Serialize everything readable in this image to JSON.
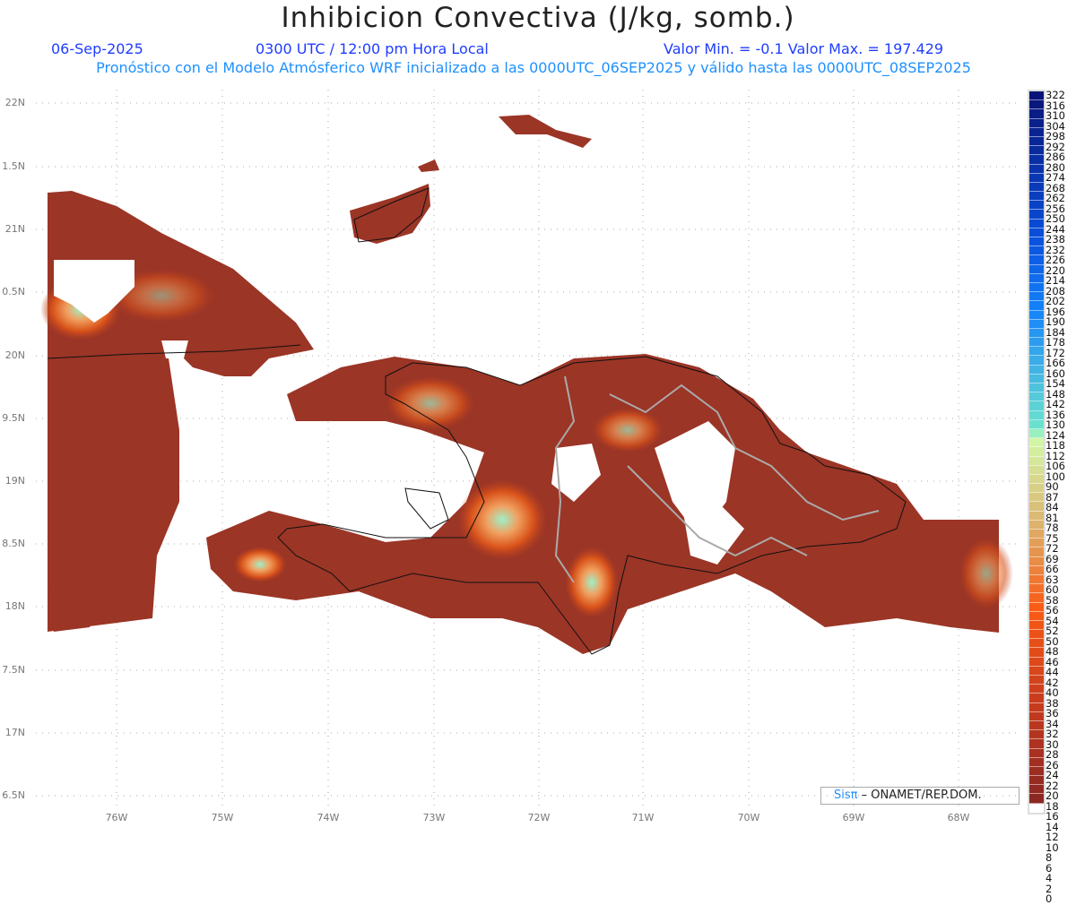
{
  "header": {
    "title": "Inhibicion Convectiva (J/kg, somb.)",
    "date": "06-Sep-2025",
    "time": "0300 UTC / 12:00 pm Hora Local",
    "minmax": "Valor Min. = -0.1  Valor Max. = 197.429",
    "subtitle": "Pronóstico con el Modelo Atmósferico WRF inicializado a las 0000UTC_06SEP2025 y válido hasta las  0000UTC_08SEP2025"
  },
  "axes": {
    "y_labels": [
      "22N",
      "1.5N",
      "21N",
      "0.5N",
      "20N",
      "9.5N",
      "19N",
      "8.5N",
      "18N",
      "7.5N",
      "17N",
      "6.5N"
    ],
    "x_labels": [
      "76W",
      "75W",
      "74W",
      "73W",
      "72W",
      "71W",
      "70W",
      "69W",
      "68W"
    ]
  },
  "colorbar": {
    "labels": [
      "322",
      "316",
      "310",
      "304",
      "298",
      "292",
      "286",
      "280",
      "274",
      "268",
      "262",
      "256",
      "250",
      "244",
      "238",
      "232",
      "226",
      "220",
      "214",
      "208",
      "202",
      "196",
      "190",
      "184",
      "178",
      "172",
      "166",
      "160",
      "154",
      "148",
      "142",
      "136",
      "130",
      "124",
      "118",
      "112",
      "106",
      "100",
      "90",
      "87",
      "84",
      "81",
      "78",
      "75",
      "72",
      "69",
      "66",
      "63",
      "60",
      "58",
      "56",
      "54",
      "52",
      "50",
      "48",
      "46",
      "44",
      "42",
      "40",
      "38",
      "36",
      "34",
      "32",
      "30",
      "28",
      "26",
      "24",
      "22",
      "20",
      "18",
      "16",
      "14",
      "12",
      "10",
      "8",
      "6",
      "4",
      "2",
      "0"
    ]
  },
  "footer": {
    "logo_brand": "Sisπ",
    "logo_text": " – ONAMET/REP.DOM."
  },
  "colors": {
    "land": "#9b3526",
    "mid": "#d9531a",
    "high": "#7fe8cf"
  }
}
